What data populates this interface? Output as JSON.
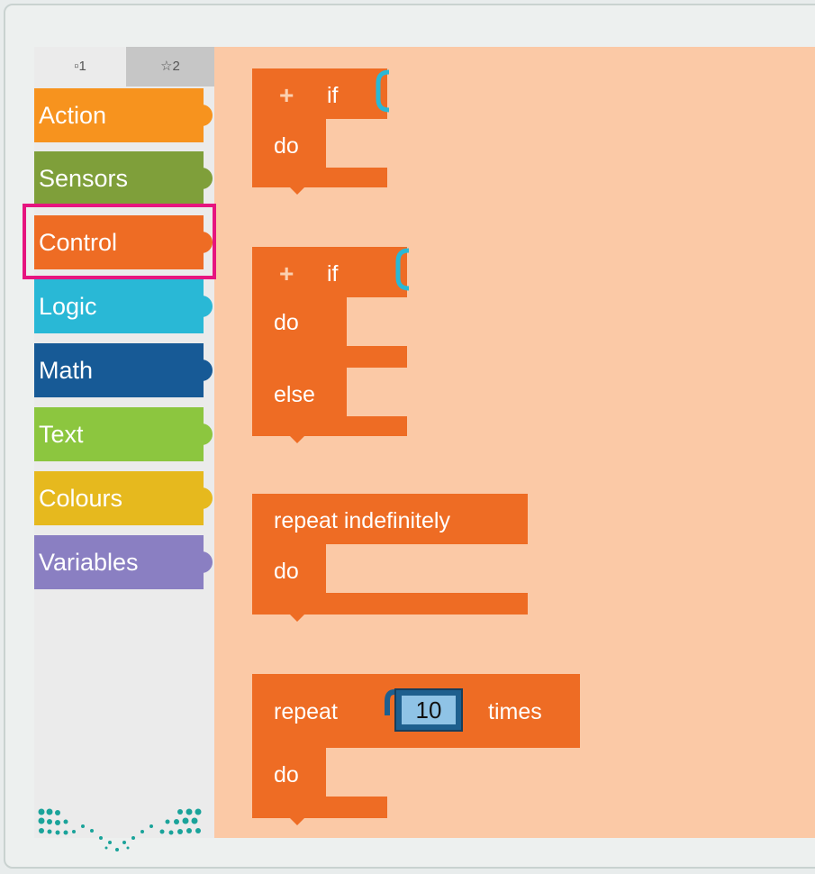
{
  "tabs": [
    {
      "icon": "square-icon",
      "label": "1"
    },
    {
      "icon": "star-icon",
      "label": "2"
    }
  ],
  "categories": [
    {
      "label": "Action",
      "color": "#f7931e"
    },
    {
      "label": "Sensors",
      "color": "#7f9f3a"
    },
    {
      "label": "Control",
      "color": "#ee6c24"
    },
    {
      "label": "Logic",
      "color": "#29b8d6"
    },
    {
      "label": "Math",
      "color": "#175a96"
    },
    {
      "label": "Text",
      "color": "#8cc63f"
    },
    {
      "label": "Colours",
      "color": "#e6b91e"
    },
    {
      "label": "Variables",
      "color": "#8a7fc2"
    }
  ],
  "selected_category": "Control",
  "colors": {
    "block": "#ee6c24",
    "workspace": "#fbc9a6",
    "highlight": "#e6157f",
    "number_block": "#1e5f8e"
  },
  "blocks": {
    "if1": {
      "plus": "+",
      "kw_if": "if",
      "kw_do": "do"
    },
    "ifelse": {
      "plus": "+",
      "kw_if": "if",
      "kw_do": "do",
      "kw_else": "else"
    },
    "forever": {
      "label": "repeat indefinitely",
      "kw_do": "do"
    },
    "repeat": {
      "label": "repeat",
      "times": "times",
      "value": "10",
      "kw_do": "do"
    }
  }
}
